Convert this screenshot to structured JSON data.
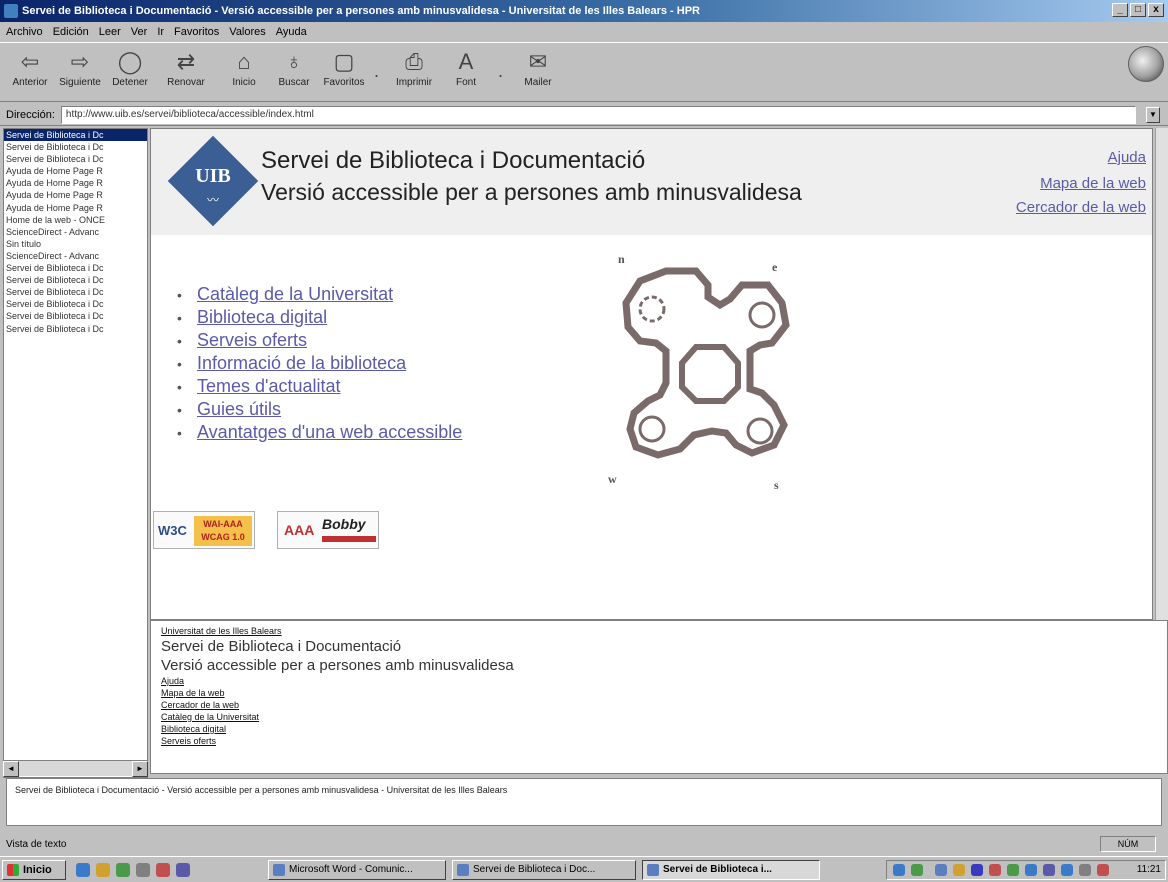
{
  "window": {
    "title": "Servei de Biblioteca i Documentació - Versió accessible per a persones amb minusvalidesa - Universitat de les Illes Balears - HPR",
    "buttons": [
      "_",
      "□",
      "x"
    ]
  },
  "menu": [
    "Archivo",
    "Edición",
    "Leer",
    "Ver",
    "Ir",
    "Favoritos",
    "Valores",
    "Ayuda"
  ],
  "toolbar": {
    "back": "Anterior",
    "forward": "Siguiente",
    "stop": "Detener",
    "refresh": "Renovar",
    "home": "Inicio",
    "search": "Buscar",
    "favorites": "Favoritos",
    "print": "Imprimir",
    "font": "Font",
    "mailer": "Mailer",
    "separator": "."
  },
  "address": {
    "label": "Dirección:",
    "url": "http://www.uib.es/servei/biblioteca/accessible/index.html"
  },
  "history": [
    "Servei de Biblioteca i Dc",
    "Servei de Biblioteca i Dc",
    "Servei de Biblioteca i Dc",
    "Ayuda de Home Page R",
    "Ayuda de Home Page R",
    "Ayuda de Home Page R",
    "Ayuda de Home Page R",
    "Home de la web - ONCE",
    "ScienceDirect - Advanc",
    "Sin título",
    "ScienceDirect - Advanc",
    "Servei de Biblioteca i Dc",
    "Servei de Biblioteca i Dc",
    "Servei de Biblioteca i Dc",
    "Servei de Biblioteca i Dc",
    "Servei de Biblioteca i Dc",
    "Servei de Biblioteca i Dc"
  ],
  "page": {
    "logo_text": "UIB",
    "title": "Servei de Biblioteca i Documentació",
    "subtitle": "Versió accessible per a persones amb minusvalidesa",
    "header_links": [
      "Ajuda",
      "Mapa de la web",
      "Cercador de la web"
    ],
    "nav": [
      "Catàleg de la Universitat",
      "Biblioteca digital",
      "Serveis oferts",
      "Informació de la biblioteca",
      "Temes d'actualitat",
      "Guies útils",
      "Avantatges d'una web accessible"
    ],
    "compass": {
      "n": "n",
      "e": "e",
      "s": "s",
      "w": "w"
    },
    "badges": {
      "w3c": "W3C",
      "wai_line1": "WAI-AAA",
      "wai_line2": "WCAG 1.0",
      "aaa": "AAA",
      "bobby": "Bobby"
    }
  },
  "bottom": {
    "org_link": "Universitat de les Illes Balears",
    "title": "Servei de Biblioteca i Documentació",
    "subtitle": "Versió accessible per a persones amb minusvalidesa",
    "links": [
      "Ajuda",
      "Mapa de la web",
      "Cercador de la web",
      "Catàleg de la Universitat",
      "Biblioteca digital",
      "Serveis oferts"
    ]
  },
  "description": "Servei de Biblioteca i Documentació - Versió accessible per a persones amb minusvalidesa - Universitat de les Illes Balears",
  "status": {
    "text": "Vista de texto",
    "num": "NÚM"
  },
  "taskbar": {
    "start": "Inicio",
    "tasks": [
      "Microsoft Word - Comunic...",
      "Servei de Biblioteca i Doc...",
      "Servei de Biblioteca i..."
    ],
    "clock": "11:21"
  },
  "colors": {
    "title_bar": "#0a246a",
    "link": "#5a5aa8",
    "logo": "#3b5f94"
  }
}
